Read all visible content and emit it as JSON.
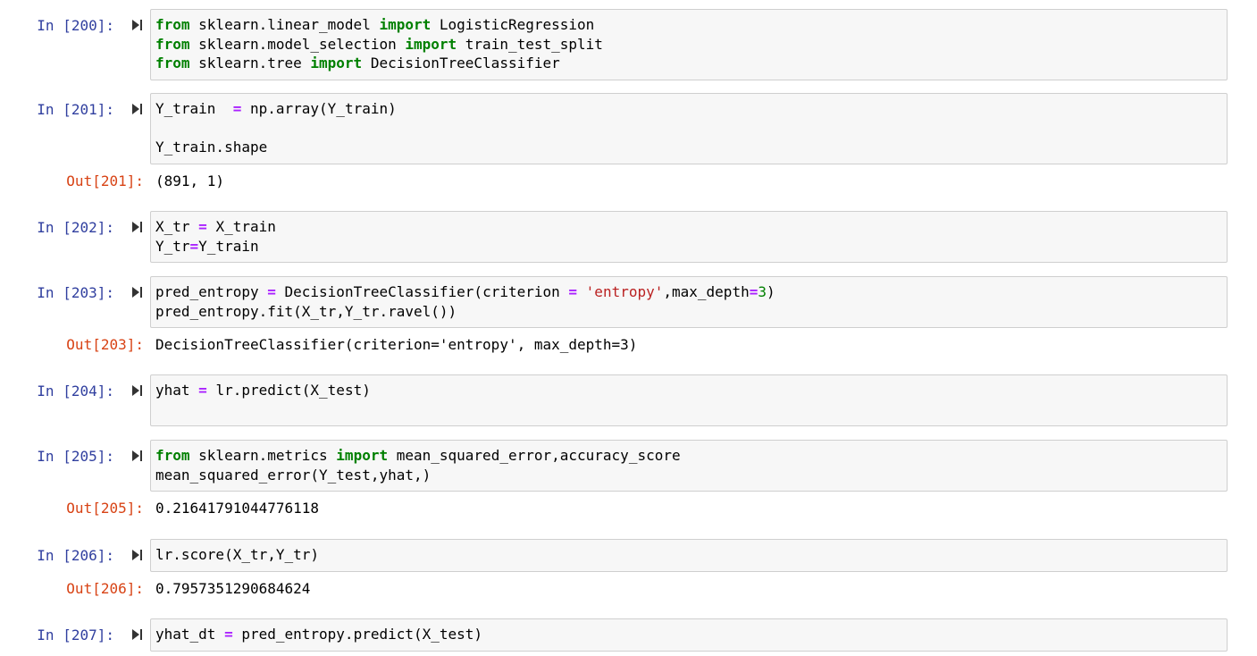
{
  "colors": {
    "in_prompt": "#303f9f",
    "out_prompt": "#d84315",
    "keyword": "#008000",
    "operator": "#aa22ff",
    "string": "#ba2121",
    "number": "#008000",
    "cell_background": "#f7f7f7",
    "cell_border": "#cfcfcf"
  },
  "icons": {
    "run": "run-cell-icon"
  },
  "cells": {
    "c200": {
      "in_prompt": "In [200]:",
      "l1_kw1": "from",
      "l1_mod": " sklearn.linear_model ",
      "l1_kw2": "import",
      "l1_name": " LogisticRegression",
      "l2_kw1": "from",
      "l2_mod": " sklearn.model_selection ",
      "l2_kw2": "import",
      "l2_name": " train_test_split",
      "l3_kw1": "from",
      "l3_mod": " sklearn.tree ",
      "l3_kw2": "import",
      "l3_name": " DecisionTreeClassifier"
    },
    "c201": {
      "in_prompt": "In [201]:",
      "l1_a": "Y_train  ",
      "l1_op": "=",
      "l1_b": " np.array(Y_train)",
      "l3": "Y_train.shape",
      "out_prompt": "Out[201]:",
      "output": "(891, 1)"
    },
    "c202": {
      "in_prompt": "In [202]:",
      "l1_a": "X_tr ",
      "l1_op": "=",
      "l1_b": " X_train",
      "l2_a": "Y_tr",
      "l2_op": "=",
      "l2_b": "Y_train"
    },
    "c203": {
      "in_prompt": "In [203]:",
      "l1_a": "pred_entropy ",
      "l1_op1": "=",
      "l1_b": " DecisionTreeClassifier(criterion ",
      "l1_op2": "=",
      "l1_c": " ",
      "l1_str": "'entropy'",
      "l1_d": ",max_depth",
      "l1_op3": "=",
      "l1_num": "3",
      "l1_e": ")",
      "l2": "pred_entropy.fit(X_tr,Y_tr.ravel())",
      "out_prompt": "Out[203]:",
      "output": "DecisionTreeClassifier(criterion='entropy', max_depth=3)"
    },
    "c204": {
      "in_prompt": "In [204]:",
      "l1_a": "yhat ",
      "l1_op": "=",
      "l1_b": " lr.predict(X_test)"
    },
    "c205": {
      "in_prompt": "In [205]:",
      "l1_kw1": "from",
      "l1_mod": " sklearn.metrics ",
      "l1_kw2": "import",
      "l1_name": " mean_squared_error,accuracy_score",
      "l2": "mean_squared_error(Y_test,yhat,)",
      "out_prompt": "Out[205]:",
      "output": "0.21641791044776118"
    },
    "c206": {
      "in_prompt": "In [206]:",
      "l1": "lr.score(X_tr,Y_tr)",
      "out_prompt": "Out[206]:",
      "output": "0.7957351290684624"
    },
    "c207": {
      "in_prompt": "In [207]:",
      "l1_a": "yhat_dt ",
      "l1_op": "=",
      "l1_b": " pred_entropy.predict(X_test)"
    }
  }
}
